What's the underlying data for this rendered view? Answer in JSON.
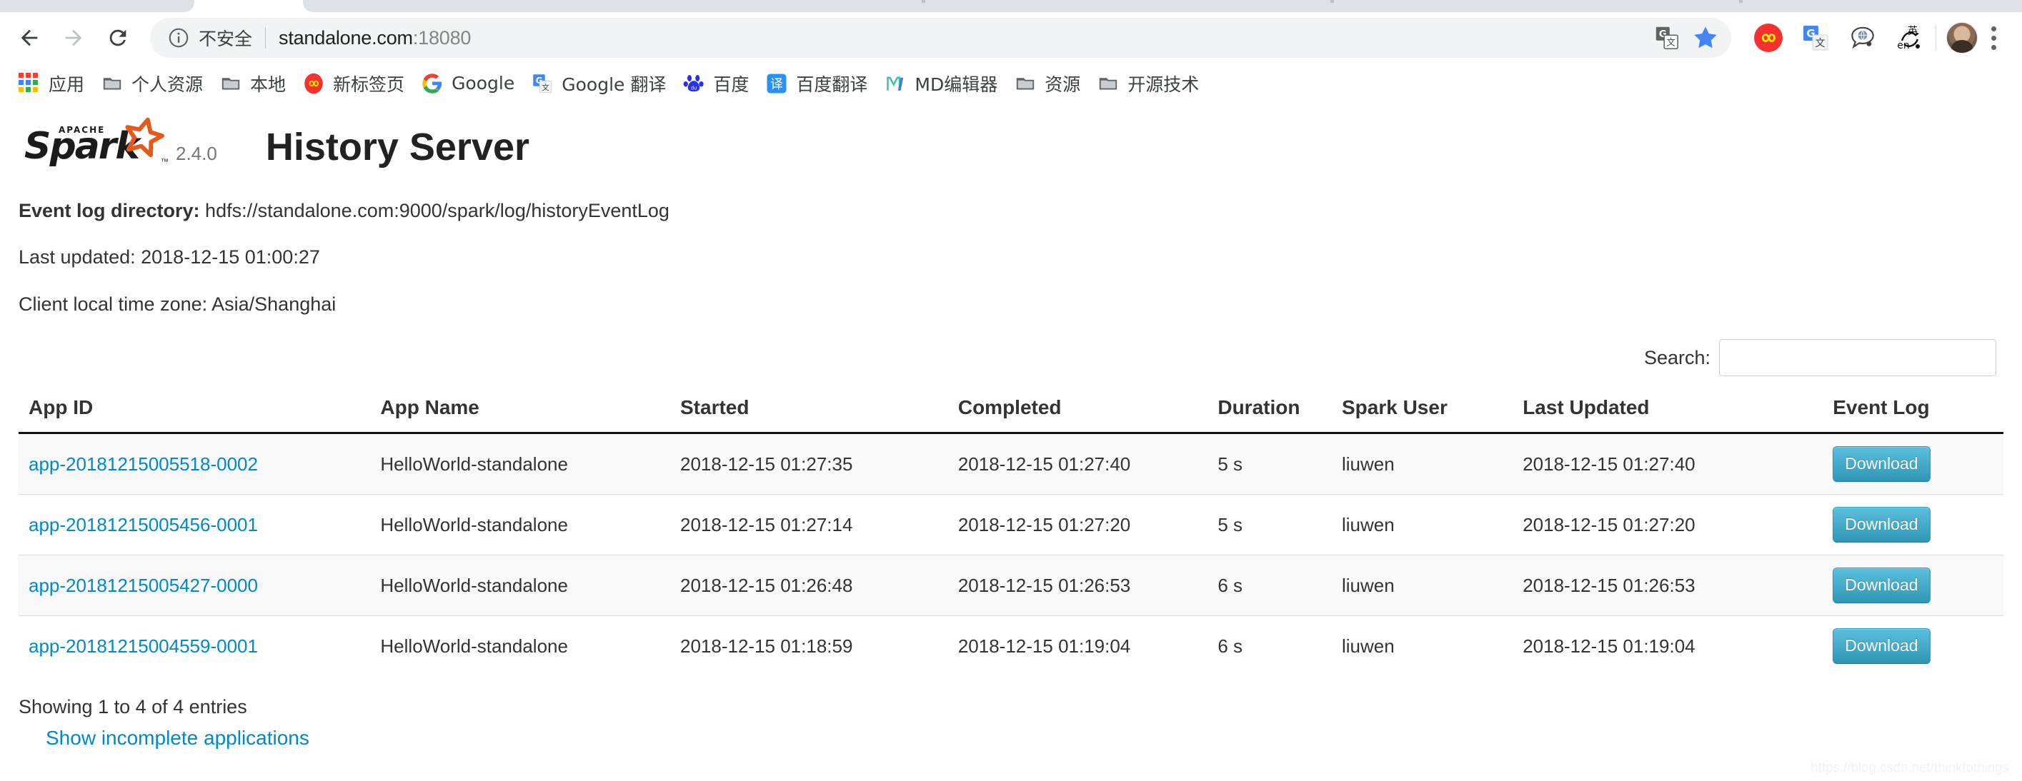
{
  "browser": {
    "nav": {
      "back": "back-arrow",
      "forward": "forward-arrow",
      "reload": "reload-arrow"
    },
    "omnibox": {
      "security_icon": "info-circle-icon",
      "security_label": "不安全",
      "url_host": "standalone.com",
      "url_port": ":18080",
      "url_full": "standalone.com:18080",
      "translate_icon": "google-translate-icon",
      "bookmark_icon": "star-icon"
    },
    "extensions": [
      {
        "name": "infinity-new-tab-extension",
        "icon": "infinity-icon"
      },
      {
        "name": "google-translate-extension",
        "icon": "google-translate-icon"
      },
      {
        "name": "speech-bubble-extension",
        "icon": "speech-bubble-globe-icon"
      },
      {
        "name": "en-jp-translate-extension",
        "icon": "en-yingcharacter-icon"
      }
    ],
    "profile": "avatar",
    "menu": "chrome-menu-kebab",
    "bookmarks": [
      {
        "label": "应用",
        "icon": "apps-grid-icon"
      },
      {
        "label": "个人资源",
        "icon": "folder-icon"
      },
      {
        "label": "本地",
        "icon": "folder-icon"
      },
      {
        "label": "新标签页",
        "icon": "infinity-icon"
      },
      {
        "label": "Google",
        "icon": "google-g-icon"
      },
      {
        "label": "Google 翻译",
        "icon": "google-translate-icon"
      },
      {
        "label": "百度",
        "icon": "baidu-paw-icon"
      },
      {
        "label": "百度翻译",
        "icon": "baidu-translate-icon"
      },
      {
        "label": "MD编辑器",
        "icon": "markdown-m-icon"
      },
      {
        "label": "资源",
        "icon": "folder-icon"
      },
      {
        "label": "开源技术",
        "icon": "folder-icon"
      }
    ]
  },
  "app": {
    "logo_word": "Spark",
    "logo_apache": "APACHE",
    "logo_tm": "™",
    "version": "2.4.0",
    "title": "History Server",
    "info": {
      "event_log_directory_label": "Event log directory:",
      "event_log_directory_value": " hdfs://standalone.com:9000/spark/log/historyEventLog",
      "last_updated": "Last updated: 2018-12-15 01:00:27",
      "client_time_zone": "Client local time zone: Asia/Shanghai"
    },
    "search": {
      "label": "Search:",
      "value": "",
      "placeholder": ""
    },
    "table": {
      "columns": [
        "App ID",
        "App Name",
        "Started",
        "Completed",
        "Duration",
        "Spark User",
        "Last Updated",
        "Event Log"
      ],
      "rows": [
        {
          "app_id": "app-20181215005518-0002",
          "app_name": "HelloWorld-standalone",
          "started": "2018-12-15 01:27:35",
          "completed": "2018-12-15 01:27:40",
          "duration": "5 s",
          "spark_user": "liuwen",
          "last_updated": "2018-12-15 01:27:40",
          "event_log": "Download"
        },
        {
          "app_id": "app-20181215005456-0001",
          "app_name": "HelloWorld-standalone",
          "started": "2018-12-15 01:27:14",
          "completed": "2018-12-15 01:27:20",
          "duration": "5 s",
          "spark_user": "liuwen",
          "last_updated": "2018-12-15 01:27:20",
          "event_log": "Download"
        },
        {
          "app_id": "app-20181215005427-0000",
          "app_name": "HelloWorld-standalone",
          "started": "2018-12-15 01:26:48",
          "completed": "2018-12-15 01:26:53",
          "duration": "6 s",
          "spark_user": "liuwen",
          "last_updated": "2018-12-15 01:26:53",
          "event_log": "Download"
        },
        {
          "app_id": "app-20181215004559-0001",
          "app_name": "HelloWorld-standalone",
          "started": "2018-12-15 01:18:59",
          "completed": "2018-12-15 01:19:04",
          "duration": "6 s",
          "spark_user": "liuwen",
          "last_updated": "2018-12-15 01:19:04",
          "event_log": "Download"
        }
      ]
    },
    "footer": {
      "entries_info": "Showing 1 to 4 of 4 entries",
      "show_incomplete": "Show incomplete applications"
    },
    "watermark": "https://blog.csdn.net/thinktothings"
  },
  "colors": {
    "link": "#0088cc",
    "download_button": "#49afcd",
    "spark_orange": "#e25a1c",
    "chrome_bookmark_star": "#4285f4"
  }
}
